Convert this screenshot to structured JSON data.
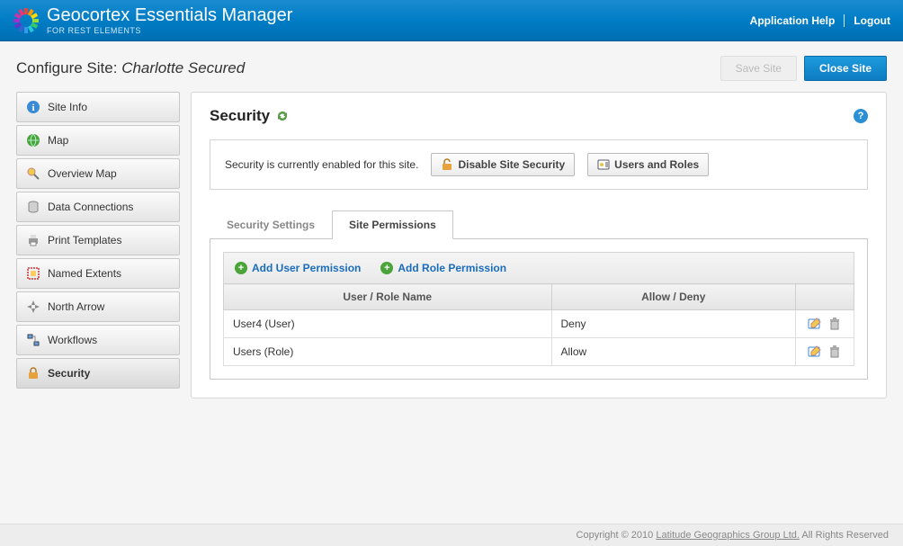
{
  "header": {
    "brand_title": "Geocortex Essentials Manager",
    "brand_sub": "FOR REST ELEMENTS",
    "help_label": "Application Help",
    "logout_label": "Logout"
  },
  "subheader": {
    "configure_prefix": "Configure Site: ",
    "site_name": "Charlotte Secured",
    "save_label": "Save Site",
    "close_label": "Close Site"
  },
  "sidebar": {
    "items": [
      {
        "label": "Site Info",
        "icon": "info"
      },
      {
        "label": "Map",
        "icon": "globe"
      },
      {
        "label": "Overview Map",
        "icon": "magnifier"
      },
      {
        "label": "Data Connections",
        "icon": "db"
      },
      {
        "label": "Print Templates",
        "icon": "printer"
      },
      {
        "label": "Named Extents",
        "icon": "extent"
      },
      {
        "label": "North Arrow",
        "icon": "arrows"
      },
      {
        "label": "Workflows",
        "icon": "workflow"
      },
      {
        "label": "Security",
        "icon": "lock",
        "active": true
      }
    ]
  },
  "panel": {
    "title": "Security",
    "notice_text": "Security is currently enabled for this site.",
    "disable_label": "Disable Site Security",
    "users_roles_label": "Users and Roles"
  },
  "tabs": {
    "settings_label": "Security Settings",
    "permissions_label": "Site Permissions"
  },
  "toolbar": {
    "add_user_label": "Add User Permission",
    "add_role_label": "Add Role Permission"
  },
  "table": {
    "col_name": "User / Role Name",
    "col_allow": "Allow / Deny",
    "rows": [
      {
        "name": "User4 (User)",
        "allow": "Deny"
      },
      {
        "name": "Users (Role)",
        "allow": "Allow"
      }
    ]
  },
  "footer": {
    "copyright_prefix": "Copyright © 2010 ",
    "company": "Latitude Geographics Group Ltd.",
    "suffix": " All Rights Reserved"
  }
}
